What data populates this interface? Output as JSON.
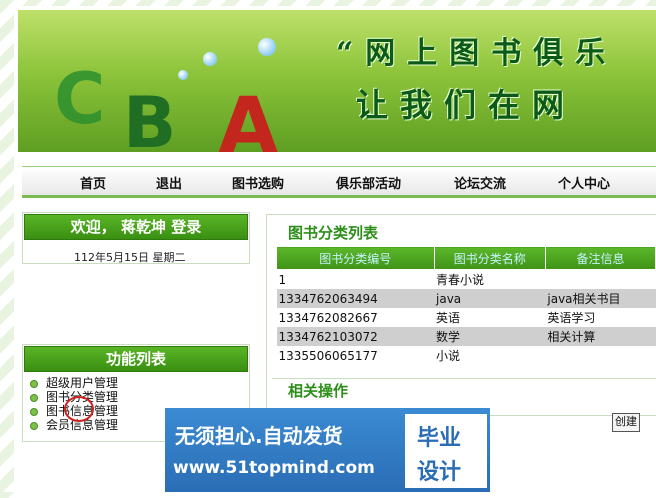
{
  "banner": {
    "slogan_line1": "“网上图书俱乐",
    "slogan_line2": "让我们在网"
  },
  "nav": {
    "items": [
      "首页",
      "退出",
      "图书选购",
      "俱乐部活动",
      "论坛交流",
      "个人中心"
    ]
  },
  "welcome": {
    "title": "欢迎， 蒋乾坤 登录",
    "date": "112年5月15日 星期二"
  },
  "functions": {
    "title": "功能列表",
    "items": [
      "超级用户管理",
      "图书分类管理",
      "图书信息管理",
      "会员信息管理"
    ]
  },
  "category": {
    "title": "图书分类列表",
    "headers": [
      "图书分类编号",
      "图书分类名称",
      "备注信息"
    ],
    "rows": [
      {
        "id": "1",
        "name": "青春小说",
        "note": ""
      },
      {
        "id": "1334762063494",
        "name": "java",
        "note": "java相关书目"
      },
      {
        "id": "1334762082667",
        "name": "英语",
        "note": "英语学习"
      },
      {
        "id": "1334762103072",
        "name": "数学",
        "note": "相关计算"
      },
      {
        "id": "1335506065177",
        "name": "小说",
        "note": ""
      }
    ]
  },
  "operations": {
    "title": "相关操作",
    "create_label": "创建"
  },
  "watermark": {
    "line1": "无须担心.自动发货",
    "line2": "www.51topmind.com",
    "right_top": "毕业",
    "right_bottom": "设计"
  },
  "colors": {
    "accent_green": "#3e9316",
    "row_gray": "#cfcfcf",
    "watermark_blue": "#2a6db5"
  }
}
